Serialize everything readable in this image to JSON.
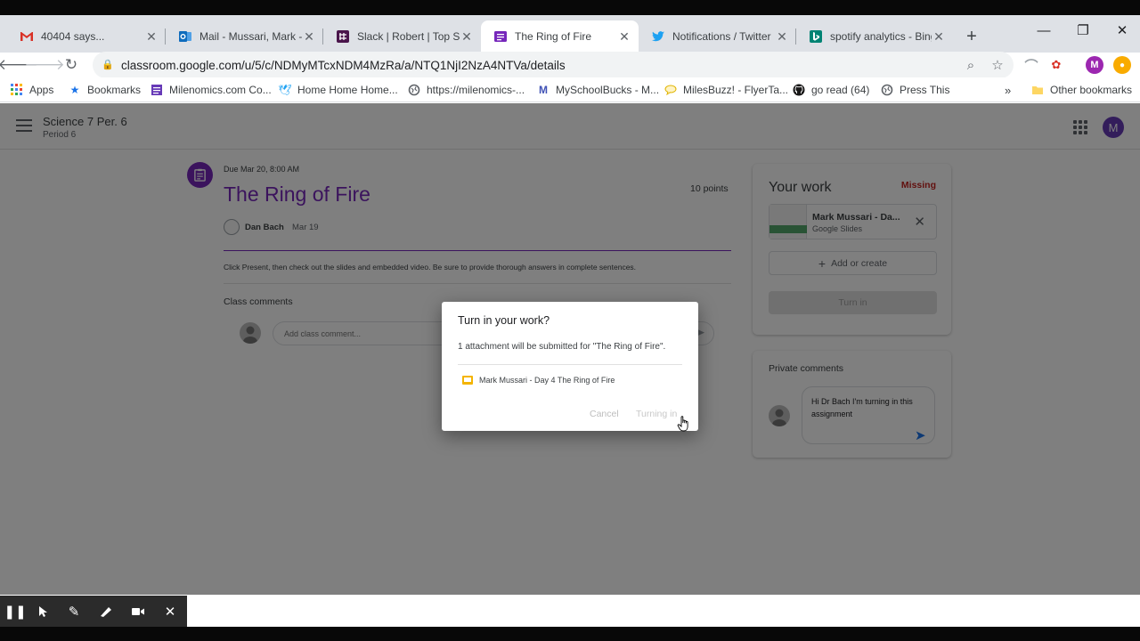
{
  "browser": {
    "tabs": [
      {
        "title": "40404 says...",
        "favicon": "gmail-icon"
      },
      {
        "title": "Mail - Mussari, Mark - (",
        "favicon": "outlook-icon"
      },
      {
        "title": "Slack | Robert | Top Sec",
        "favicon": "slack-icon"
      },
      {
        "title": "The Ring of Fire",
        "favicon": "classroom-icon",
        "active": true
      },
      {
        "title": "Notifications / Twitter",
        "favicon": "twitter-icon"
      },
      {
        "title": "spotify analytics - Bing",
        "favicon": "bing-icon"
      }
    ],
    "url": "classroom.google.com/u/5/c/NDMyMTcxNDM4MzRa/a/NTQ1NjI2NzA4NTVa/details",
    "profile_initial": "M",
    "bookmarks": [
      {
        "label": "Apps",
        "icon": "apps-grid-icon"
      },
      {
        "label": "Bookmarks",
        "icon": "star-icon"
      },
      {
        "label": "Milenomics.com Co...",
        "icon": "doc-icon"
      },
      {
        "label": "Home Home Home...",
        "icon": "twitter-icon"
      },
      {
        "label": "https://milenomics-...",
        "icon": "globe-icon"
      },
      {
        "label": "MySchoolBucks - M...",
        "icon": "m-icon"
      },
      {
        "label": "MilesBuzz! - FlyerTa...",
        "icon": "chat-icon"
      },
      {
        "label": "go read (64)",
        "icon": "github-icon"
      },
      {
        "label": "Press This",
        "icon": "globe-icon"
      }
    ],
    "other_bookmarks": "Other bookmarks",
    "overflow": "»"
  },
  "classroom": {
    "class_name": "Science 7 Per. 6",
    "period": "Period 6",
    "profile_initial": "M",
    "assignment": {
      "due": "Due Mar 20, 8:00 AM",
      "title": "The Ring of Fire",
      "points": "10 points",
      "teacher": "Dan Bach",
      "posted": "Mar 19",
      "instructions": "Click Present, then check out the slides and embedded video. Be sure to provide thorough answers in complete sentences."
    },
    "class_comments": {
      "label": "Class comments",
      "placeholder": "Add class comment..."
    },
    "your_work": {
      "title": "Your work",
      "status": "Missing",
      "attachment_name": "Mark Mussari - Da...",
      "attachment_type": "Google Slides",
      "add_or_create": "Add or create",
      "turn_in": "Turn in"
    },
    "private_comments": {
      "title": "Private comments",
      "text": "Hi Dr Bach I'm turning in this assignment"
    }
  },
  "dialog": {
    "title": "Turn in your work?",
    "body": "1 attachment will be submitted for \"The Ring of Fire\".",
    "attachment": "Mark Mussari - Day 4 The Ring of Fire",
    "cancel": "Cancel",
    "turning_in": "Turning in"
  },
  "colors": {
    "accent": "#7627bb",
    "missing": "#c5221f",
    "slides": "#f4b400"
  }
}
